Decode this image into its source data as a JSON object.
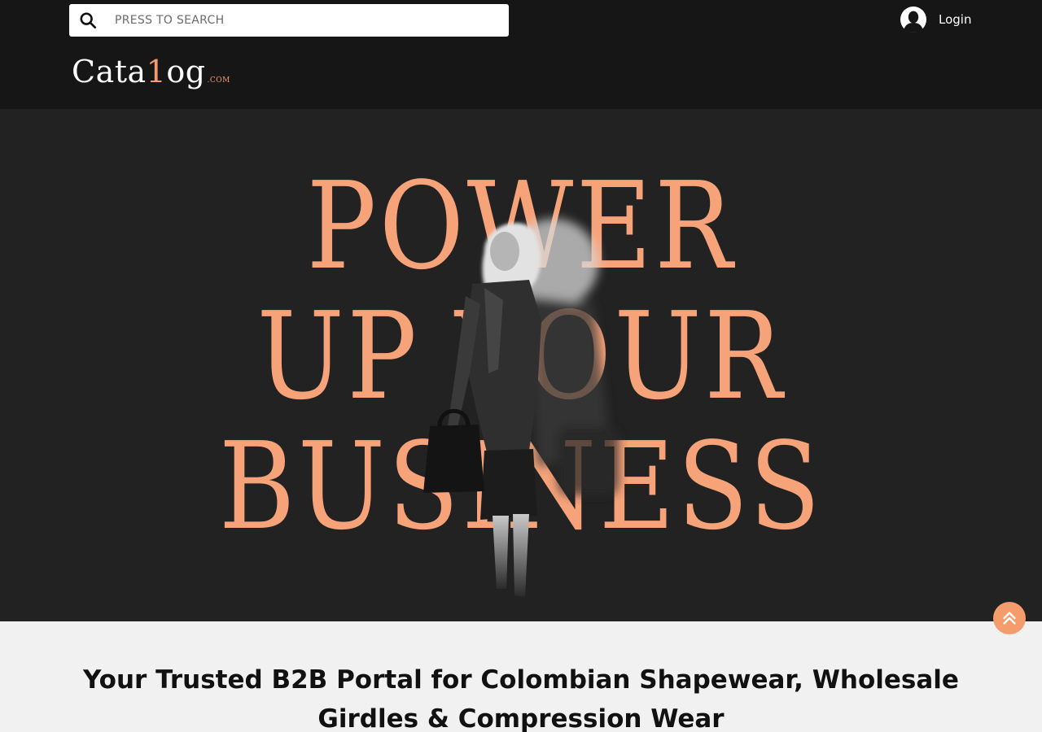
{
  "search": {
    "placeholder": "PRESS TO SEARCH",
    "value": ""
  },
  "header": {
    "login_label": "Login",
    "logo": {
      "main_start": "Cata",
      "main_accent": "1",
      "main_end": "og",
      "tld": ".COM"
    }
  },
  "hero": {
    "line1": "POWER",
    "line2": "UP YOUR",
    "line3": "BUSINESS"
  },
  "main": {
    "tagline": "Your Trusted B2B Portal for Colombian Shapewear, Wholesale Girdles & Compression Wear"
  },
  "colors": {
    "accent": "#f49c6b",
    "header_bg": "#161616",
    "hero_bg": "#222222",
    "page_bg": "#f1f1f1"
  },
  "icons": {
    "search": "search-icon",
    "avatar": "user-avatar-icon",
    "scroll_top": "double-chevron-up-icon"
  }
}
